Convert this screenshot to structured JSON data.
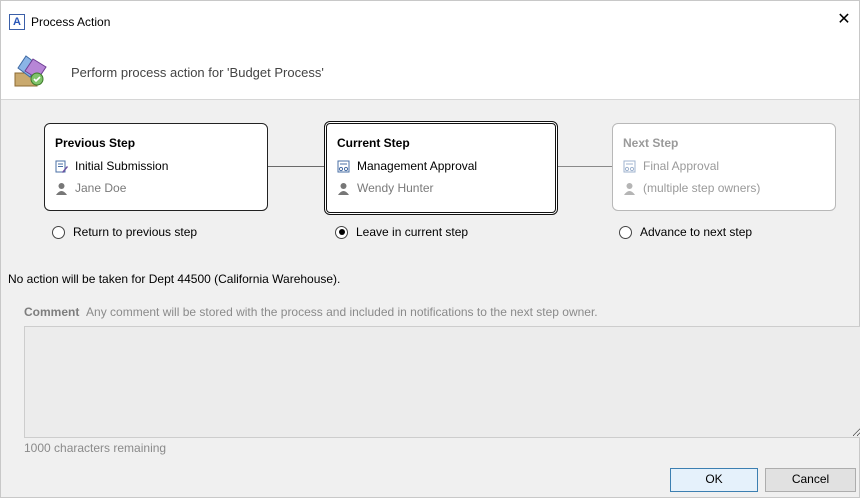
{
  "window": {
    "title": "Process Action",
    "app_icon_letter": "A",
    "close_glyph": "✕"
  },
  "header": {
    "text": "Perform process action for 'Budget Process'",
    "icon": "process-action-icon"
  },
  "steps": {
    "previous": {
      "title": "Previous Step",
      "step_name": "Initial Submission",
      "owner": "Jane Doe",
      "step_icon": "form-edit-icon",
      "owner_icon": "user-icon"
    },
    "current": {
      "title": "Current Step",
      "step_name": "Management Approval",
      "owner": "Wendy Hunter",
      "step_icon": "approval-icon",
      "owner_icon": "user-icon"
    },
    "next": {
      "title": "Next Step",
      "step_name": "Final Approval",
      "owner": "(multiple step owners)",
      "step_icon": "approval-icon",
      "owner_icon": "user-icon"
    }
  },
  "options": {
    "return": {
      "label": "Return to previous step",
      "selected": false
    },
    "leave": {
      "label": "Leave in current step",
      "selected": true
    },
    "advance": {
      "label": "Advance to next step",
      "selected": false
    }
  },
  "info": "No action will be taken for Dept 44500 (California Warehouse).",
  "comment": {
    "label": "Comment",
    "hint": "Any comment will be stored with the process and included in notifications to the next step owner.",
    "value": "",
    "remaining": "1000 characters remaining"
  },
  "buttons": {
    "ok": "OK",
    "cancel": "Cancel"
  }
}
